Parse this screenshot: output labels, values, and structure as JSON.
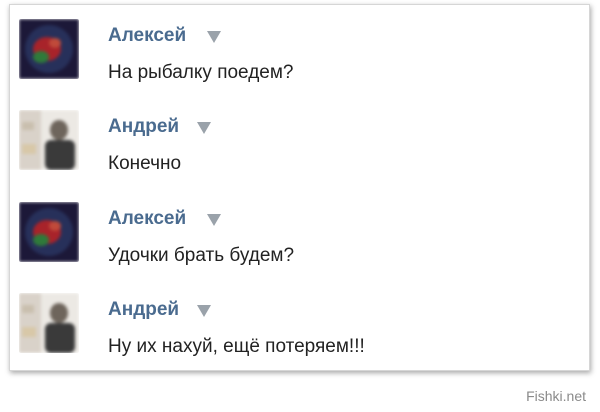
{
  "messages": [
    {
      "author": "Алексей",
      "text": "На рыбалку поедем?",
      "avatar": "alexey"
    },
    {
      "author": "Андрей",
      "text": "Конечно",
      "avatar": "andrey"
    },
    {
      "author": "Алексей",
      "text": "Удочки брать будем?",
      "avatar": "alexey"
    },
    {
      "author": "Андрей",
      "text": "Ну их нахуй, ещё потеряем!!!",
      "avatar": "andrey"
    }
  ],
  "watermark": "Fishki.net",
  "colors": {
    "author_name": "#4a6b8f",
    "message_text": "#222222",
    "caret": "#9aa2aa"
  },
  "icons": {
    "caret": "caret-down-icon"
  }
}
